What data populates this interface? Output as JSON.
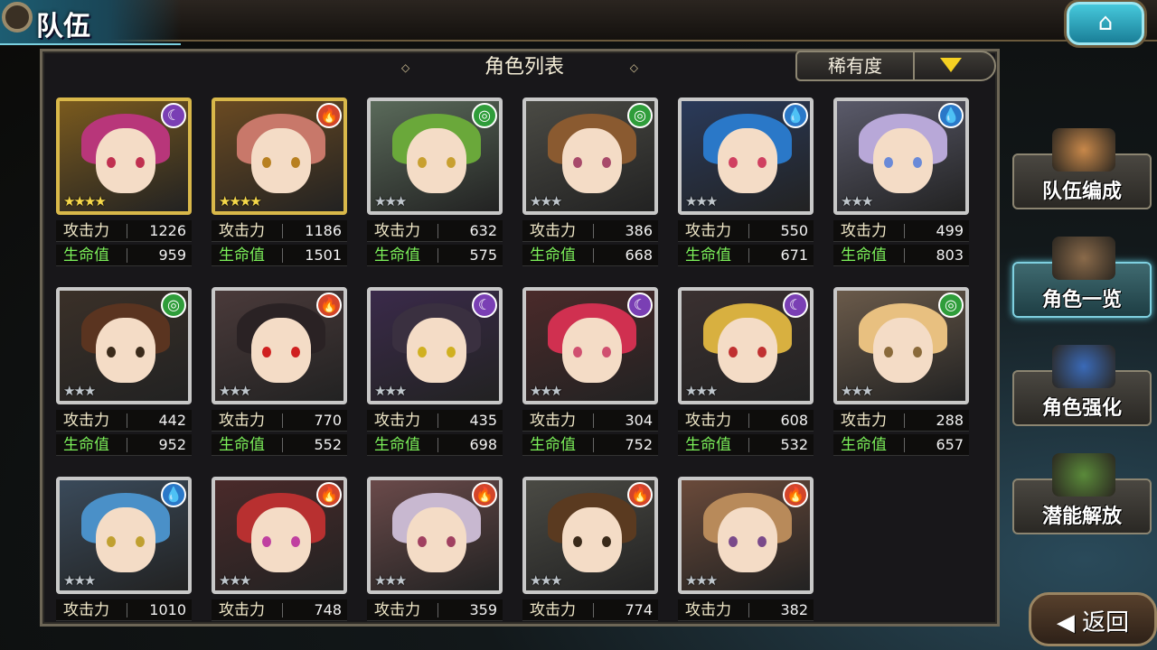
{
  "header": {
    "title": "队伍",
    "home_icon": "home-icon"
  },
  "list": {
    "title": "角色列表",
    "sort_label": "稀有度",
    "sort_icon": "triangle-down-icon"
  },
  "labels": {
    "attack": "攻击力",
    "hp": "生命值"
  },
  "elements": {
    "dark": "☾",
    "fire": "🔥",
    "wind": "◎",
    "water": "💧"
  },
  "element_colors": {
    "dark": "#7a3fb4",
    "fire": "#d2452a",
    "wind": "#2f9d3a",
    "water": "#2a78c8"
  },
  "characters": [
    {
      "element": "dark",
      "stars": "★★★★",
      "rare": true,
      "atk": "1226",
      "hp": "959"
    },
    {
      "element": "fire",
      "stars": "★★★★",
      "rare": true,
      "atk": "1186",
      "hp": "1501"
    },
    {
      "element": "wind",
      "stars": "★★★",
      "rare": false,
      "atk": "632",
      "hp": "575"
    },
    {
      "element": "wind",
      "stars": "★★★",
      "rare": false,
      "atk": "386",
      "hp": "668"
    },
    {
      "element": "water",
      "stars": "★★★",
      "rare": false,
      "atk": "550",
      "hp": "671"
    },
    {
      "element": "water",
      "stars": "★★★",
      "rare": false,
      "atk": "499",
      "hp": "803"
    },
    {
      "element": "wind",
      "stars": "★★★",
      "rare": false,
      "atk": "442",
      "hp": "952"
    },
    {
      "element": "fire",
      "stars": "★★★",
      "rare": false,
      "atk": "770",
      "hp": "552"
    },
    {
      "element": "dark",
      "stars": "★★★",
      "rare": false,
      "atk": "435",
      "hp": "698"
    },
    {
      "element": "dark",
      "stars": "★★★",
      "rare": false,
      "atk": "304",
      "hp": "752"
    },
    {
      "element": "dark",
      "stars": "★★★",
      "rare": false,
      "atk": "608",
      "hp": "532"
    },
    {
      "element": "wind",
      "stars": "★★★",
      "rare": false,
      "atk": "288",
      "hp": "657"
    },
    {
      "element": "water",
      "stars": "★★★",
      "rare": false,
      "atk": "1010",
      "hp": ""
    },
    {
      "element": "fire",
      "stars": "★★★",
      "rare": false,
      "atk": "748",
      "hp": ""
    },
    {
      "element": "fire",
      "stars": "★★★",
      "rare": false,
      "atk": "359",
      "hp": ""
    },
    {
      "element": "fire",
      "stars": "★★★",
      "rare": false,
      "atk": "774",
      "hp": ""
    },
    {
      "element": "fire",
      "stars": "★★★",
      "rare": false,
      "atk": "382",
      "hp": ""
    }
  ],
  "portrait_palette": [
    {
      "hair": "#b8367a",
      "bg": "#7a5a1e",
      "eye": "#c03050"
    },
    {
      "hair": "#c8786a",
      "bg": "#6a4a22",
      "eye": "#b88020"
    },
    {
      "hair": "#6aa83a",
      "bg": "#5a6a5a",
      "eye": "#c8a030"
    },
    {
      "hair": "#8a5a30",
      "bg": "#4a4a44",
      "eye": "#a84a6a"
    },
    {
      "hair": "#2a78c8",
      "bg": "#2a3a5a",
      "eye": "#d04060"
    },
    {
      "hair": "#b8a8d8",
      "bg": "#5a5a6a",
      "eye": "#6a8ad8"
    },
    {
      "hair": "#5a3420",
      "bg": "#3a3028",
      "eye": "#3a2a1a"
    },
    {
      "hair": "#2a2224",
      "bg": "#4a3a3a",
      "eye": "#d02020"
    },
    {
      "hair": "#3a3040",
      "bg": "#3a2a4a",
      "eye": "#d0b020"
    },
    {
      "hair": "#d03050",
      "bg": "#4a2a2a",
      "eye": "#d05070"
    },
    {
      "hair": "#d8b040",
      "bg": "#3a3030",
      "eye": "#c03030"
    },
    {
      "hair": "#e8c080",
      "bg": "#6a5a4a",
      "eye": "#8a6a3a"
    },
    {
      "hair": "#4a90c8",
      "bg": "#3a4a5a",
      "eye": "#c0a030"
    },
    {
      "hair": "#b83030",
      "bg": "#4a2a2a",
      "eye": "#c040a0"
    },
    {
      "hair": "#c8b8d0",
      "bg": "#6a4a4a",
      "eye": "#a04060"
    },
    {
      "hair": "#5a3a20",
      "bg": "#4a4a44",
      "eye": "#3a2a1a"
    },
    {
      "hair": "#b88a5a",
      "bg": "#6a4a3a",
      "eye": "#7a4a8a"
    }
  ],
  "sidebar": [
    {
      "label": "队伍编成",
      "icon": "team-faces-icon",
      "active": false
    },
    {
      "label": "角色一览",
      "icon": "book-icon",
      "active": true
    },
    {
      "label": "角色强化",
      "icon": "crystal-icon",
      "active": false
    },
    {
      "label": "潜能解放",
      "icon": "orb-icon",
      "active": false
    }
  ],
  "back": {
    "label": "◀ 返回"
  }
}
